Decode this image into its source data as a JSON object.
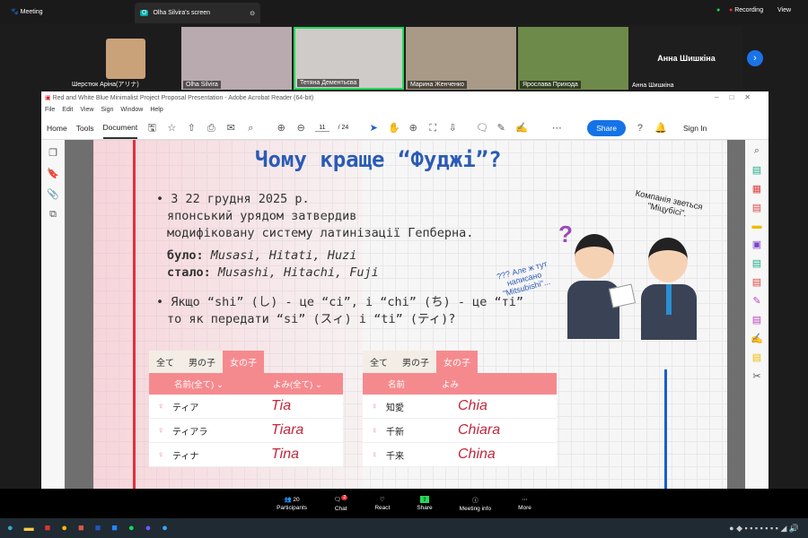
{
  "zoom": {
    "meeting_label": "Meeting",
    "screen_tab": "Olha Silvira's screen",
    "recording": "Recording",
    "view": "View",
    "participants": [
      {
        "name": "Шерстюк Аріна(アリナ)"
      },
      {
        "name": "Olha Silvira"
      },
      {
        "name": "Тетяна Дементьєва"
      },
      {
        "name": "Марина Женченко"
      },
      {
        "name": "Ярослава Приходa"
      },
      {
        "name": "Анна Шишкіна"
      }
    ],
    "featured_name": "Анна Шишкіна",
    "controls": [
      {
        "label": "Participants",
        "count": "20"
      },
      {
        "label": "Chat",
        "badge": "2"
      },
      {
        "label": "React"
      },
      {
        "label": "Share"
      },
      {
        "label": "Meeting info"
      },
      {
        "label": "More"
      }
    ]
  },
  "acrobat": {
    "title": "Red and White Blue Minimalist Project Proposal Presentation - Adobe Acrobat Reader (64-bit)",
    "menu": [
      "File",
      "Edit",
      "View",
      "Sign",
      "Window",
      "Help"
    ],
    "tabs": [
      "Home",
      "Tools",
      "Document"
    ],
    "page_current": "11",
    "page_total": "/ 24",
    "share": "Share",
    "sign_in": "Sign In"
  },
  "slide": {
    "title": "Чому краще “Фуджі”?",
    "b1_l1": "• З 22 грудня 2025 р.",
    "b1_l2": "японський урядом затвердив",
    "b1_l3": "модифіковану систему латинізації Гепберна.",
    "was_label": "було:",
    "was": " Musasi, Hitati, Huzi",
    "now_label": "стало:",
    "now": " Musashi, Hitachi, Fuji",
    "b2_l1": "• Якщо “shi” (し) - це “сі”, і “chi” (ち) - це “ті”",
    "b2_l2": "то як передати “si” (スィ) і “ti” (ティ)?",
    "bubble_left": "??? Але ж тут написано \"Mitsubishi\"...",
    "bubble_right": "Компанія зветься \"Міцубісі\".",
    "question_mark": "?",
    "tables": [
      {
        "tabs": [
          "全て",
          "男の子",
          "女の子"
        ],
        "headers": [
          "名前(全て) ⌄",
          "よみ(全て) ⌄"
        ],
        "rows": [
          [
            "ティア",
            "Tia"
          ],
          [
            "ティアラ",
            "Tiara"
          ],
          [
            "ティナ",
            "Tina"
          ]
        ]
      },
      {
        "tabs": [
          "全て",
          "男の子",
          "女の子"
        ],
        "headers": [
          "名前",
          "よみ"
        ],
        "rows": [
          [
            "知愛",
            "Chia"
          ],
          [
            "千新",
            "Chiara"
          ],
          [
            "千来",
            "China"
          ]
        ]
      }
    ]
  },
  "colors": {
    "title_blue": "#2a5bb5",
    "accent_red": "#e0313c",
    "pink": "#f58a8e",
    "zoom_green": "#23d959"
  }
}
